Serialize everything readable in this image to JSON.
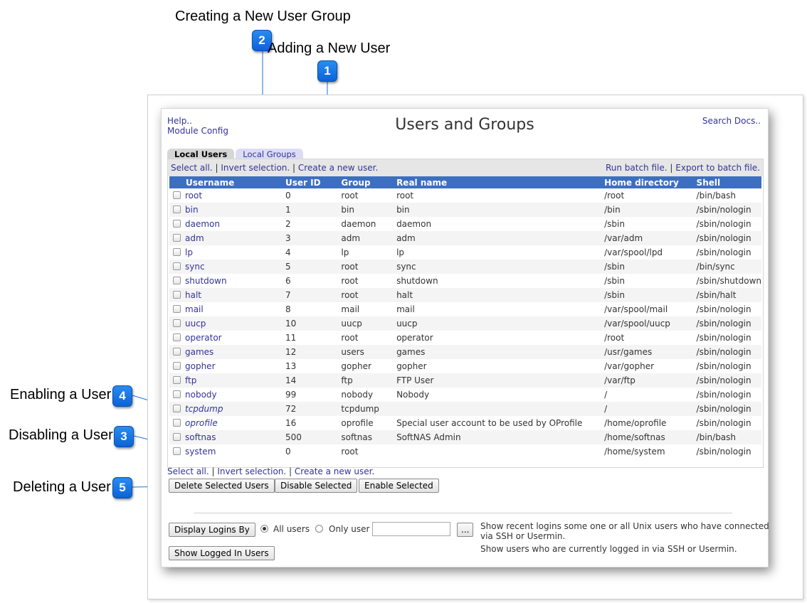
{
  "callouts": [
    {
      "num": "2",
      "label": "Creating a New User Group"
    },
    {
      "num": "1",
      "label": "Adding a New User"
    },
    {
      "num": "4",
      "label": "Enabling a User"
    },
    {
      "num": "3",
      "label": "Disabling a User"
    },
    {
      "num": "5",
      "label": "Deleting a User"
    }
  ],
  "header": {
    "help": "Help..",
    "module_config": "Module Config",
    "title": "Users and Groups",
    "search_docs": "Search Docs.."
  },
  "tabs": [
    {
      "label": "Local Users",
      "active": true
    },
    {
      "label": "Local Groups",
      "active": false
    }
  ],
  "actions": {
    "select_all": "Select all.",
    "invert": "Invert selection.",
    "create": "Create a new user.",
    "run_batch": "Run batch file.",
    "export_batch": "Export to batch file.",
    "sep": "|"
  },
  "columns": [
    "Username",
    "User ID",
    "Group",
    "Real name",
    "Home directory",
    "Shell"
  ],
  "rows": [
    {
      "username": "root",
      "uid": "0",
      "group": "root",
      "real": "root",
      "home": "/root",
      "shell": "/bin/bash",
      "italic": false
    },
    {
      "username": "bin",
      "uid": "1",
      "group": "bin",
      "real": "bin",
      "home": "/bin",
      "shell": "/sbin/nologin",
      "italic": false
    },
    {
      "username": "daemon",
      "uid": "2",
      "group": "daemon",
      "real": "daemon",
      "home": "/sbin",
      "shell": "/sbin/nologin",
      "italic": false
    },
    {
      "username": "adm",
      "uid": "3",
      "group": "adm",
      "real": "adm",
      "home": "/var/adm",
      "shell": "/sbin/nologin",
      "italic": false
    },
    {
      "username": "lp",
      "uid": "4",
      "group": "lp",
      "real": "lp",
      "home": "/var/spool/lpd",
      "shell": "/sbin/nologin",
      "italic": false
    },
    {
      "username": "sync",
      "uid": "5",
      "group": "root",
      "real": "sync",
      "home": "/sbin",
      "shell": "/bin/sync",
      "italic": false
    },
    {
      "username": "shutdown",
      "uid": "6",
      "group": "root",
      "real": "shutdown",
      "home": "/sbin",
      "shell": "/sbin/shutdown",
      "italic": false
    },
    {
      "username": "halt",
      "uid": "7",
      "group": "root",
      "real": "halt",
      "home": "/sbin",
      "shell": "/sbin/halt",
      "italic": false
    },
    {
      "username": "mail",
      "uid": "8",
      "group": "mail",
      "real": "mail",
      "home": "/var/spool/mail",
      "shell": "/sbin/nologin",
      "italic": false
    },
    {
      "username": "uucp",
      "uid": "10",
      "group": "uucp",
      "real": "uucp",
      "home": "/var/spool/uucp",
      "shell": "/sbin/nologin",
      "italic": false
    },
    {
      "username": "operator",
      "uid": "11",
      "group": "root",
      "real": "operator",
      "home": "/root",
      "shell": "/sbin/nologin",
      "italic": false
    },
    {
      "username": "games",
      "uid": "12",
      "group": "users",
      "real": "games",
      "home": "/usr/games",
      "shell": "/sbin/nologin",
      "italic": false
    },
    {
      "username": "gopher",
      "uid": "13",
      "group": "gopher",
      "real": "gopher",
      "home": "/var/gopher",
      "shell": "/sbin/nologin",
      "italic": false
    },
    {
      "username": "ftp",
      "uid": "14",
      "group": "ftp",
      "real": "FTP User",
      "home": "/var/ftp",
      "shell": "/sbin/nologin",
      "italic": false
    },
    {
      "username": "nobody",
      "uid": "99",
      "group": "nobody",
      "real": "Nobody",
      "home": "/",
      "shell": "/sbin/nologin",
      "italic": false
    },
    {
      "username": "tcpdump",
      "uid": "72",
      "group": "tcpdump",
      "real": "",
      "home": "/",
      "shell": "/sbin/nologin",
      "italic": true
    },
    {
      "username": "oprofile",
      "uid": "16",
      "group": "oprofile",
      "real": "Special user account to be used by OProfile",
      "home": "/home/oprofile",
      "shell": "/sbin/nologin",
      "italic": true
    },
    {
      "username": "softnas",
      "uid": "500",
      "group": "softnas",
      "real": "SoftNAS Admin",
      "home": "/home/softnas",
      "shell": "/bin/bash",
      "italic": false
    },
    {
      "username": "system",
      "uid": "0",
      "group": "root",
      "real": "",
      "home": "/home/system",
      "shell": "/sbin/nologin",
      "italic": false
    }
  ],
  "buttons": {
    "delete": "Delete Selected Users",
    "disable": "Disable Selected",
    "enable": "Enable Selected",
    "display_logins": "Display Logins By",
    "browse": "...",
    "show_logged": "Show Logged In Users"
  },
  "logins": {
    "all_users": "All users",
    "only_user": "Only user",
    "only_user_value": "",
    "desc1": "Show recent logins some one or all Unix users who have connected",
    "desc2": "via SSH or Usermin.",
    "desc3": "Show users who are currently logged in via SSH or Usermin."
  }
}
